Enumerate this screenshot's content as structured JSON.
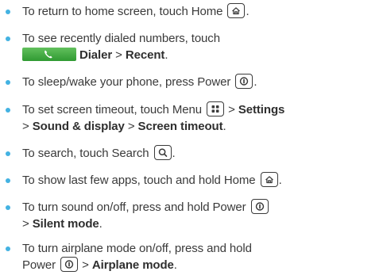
{
  "items": [
    {
      "text": "To return to home screen, touch Home",
      "end": "."
    },
    {
      "text": "To see recently dialed numbers, touch",
      "bold1": "Dialer",
      "sep": " > ",
      "bold2": "Recent",
      "end": "."
    },
    {
      "text": "To sleep/wake your phone, press Power",
      "end": "."
    },
    {
      "text": "To set screen timeout, touch Menu",
      "sep1": " > ",
      "bold1": "Settings",
      "sep2": "> ",
      "bold2": "Sound & display",
      "sep3": " > ",
      "bold3": "Screen timeout",
      "end": "."
    },
    {
      "text": "To search, touch Search",
      "end": "."
    },
    {
      "text": "To show last few apps, touch and hold Home",
      "end": "."
    },
    {
      "text": "To turn sound on/off, press and hold Power",
      "sep": "> ",
      "bold1": "Silent mode",
      "end": "."
    },
    {
      "text": "To turn airplane mode on/off, press and hold",
      "text2": "Power",
      "sep": " > ",
      "bold1": "Airplane mode",
      "end": "."
    }
  ],
  "icons": {
    "home": "home-icon",
    "power": "power-icon",
    "menu": "menu-icon",
    "search": "search-icon",
    "dialer": "phone-icon"
  },
  "colors": {
    "bullet": "#43b2e2",
    "dialer_button": "#3fa83e"
  }
}
